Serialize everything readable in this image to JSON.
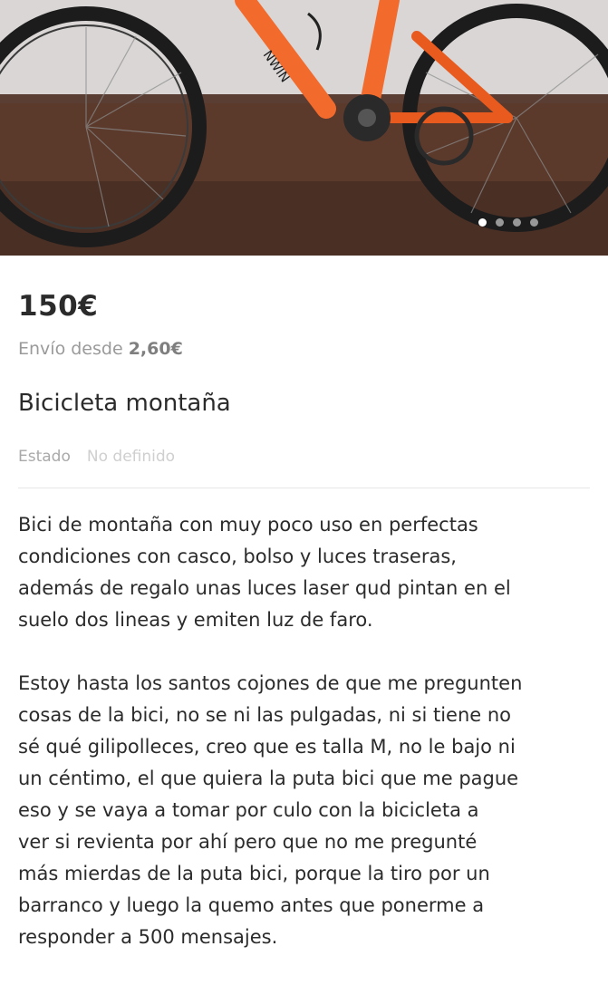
{
  "listing": {
    "price": "150€",
    "shipping_prefix": "Envío desde",
    "shipping_amount": "2,60€",
    "title": "Bicicleta montaña",
    "state_label": "Estado",
    "state_value": "No definido",
    "description_paragraph_1": "Bici de montaña con muy poco uso en perfectas\ncondiciones con casco, bolso y luces traseras,\nademás de regalo unas luces laser qud pintan en el\nsuelo dos lineas y emiten luz de faro.",
    "description_paragraph_2": "Estoy hasta los santos cojones de que me pregunten\ncosas de la bici, no se ni las pulgadas, ni si tiene no\nsé qué gilipolleces, creo que es talla M, no le bajo ni\nun céntimo, el que quiera la puta bici que me pague\neso y se vaya a tomar por culo con la bicicleta a\nver si revienta por ahí pero que no me pregunté\nmás mierdas de la puta bici, porque la tiro por un\nbarranco y luego la quemo antes que ponerme a\nresponder a 500 mensajes."
  },
  "photo": {
    "icon": "bicycle-photo",
    "frame_color": "#f26a2c",
    "carousel_pages": 4,
    "carousel_active_page": 1
  }
}
